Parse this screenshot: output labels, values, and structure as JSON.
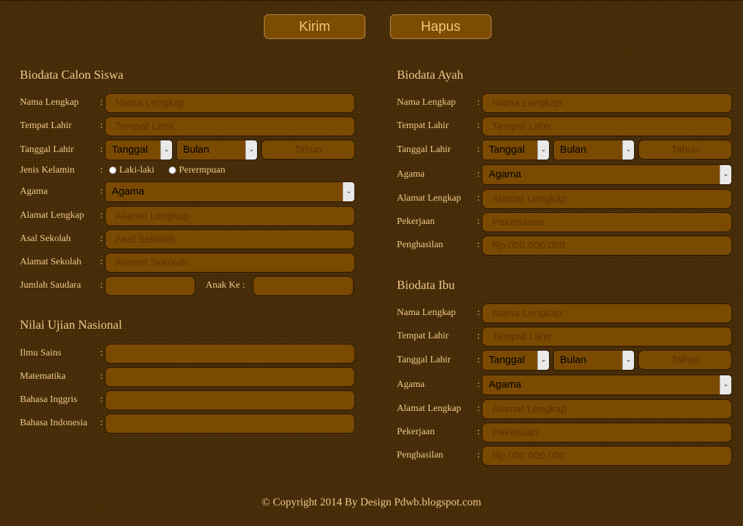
{
  "buttons": {
    "submit": "Kirim",
    "reset": "Hapus"
  },
  "siswa": {
    "title": "Biodata Calon Siswa",
    "nama_label": "Nama Lengkap",
    "nama_ph": "Nama Lengkap",
    "tempat_label": "Tempat Lahir",
    "tempat_ph": "Tempat Lahir",
    "tanggal_label": "Tanggal Lahir",
    "tanggal_sel": "Tanggal",
    "bulan_sel": "Bulan",
    "tahun_ph": "Tahun",
    "jk_label": "Jenis Kelamin",
    "jk_male": "Laki-laki",
    "jk_female": "Perermpuan",
    "agama_label": "Agama",
    "agama_sel": "Agama",
    "alamat_label": "Alamat Lengkap",
    "alamat_ph": "Alamat Lengkap",
    "asal_label": "Asal Sekolah",
    "asal_ph": "Asal Sekolah",
    "alamat_sekolah_label": "Alamat Sekolah",
    "alamat_sekolah_ph": "Alamat Sekolah",
    "saudara_label": "Jumlah Saudara",
    "anak_ke_label": "Anak Ke :"
  },
  "nilai": {
    "title": "Nilai Ujian Nasional",
    "sains": "Ilmu Sains",
    "mtk": "Matematika",
    "inggris": "Bahasa Inggris",
    "indo": "Bahasa Indonesia"
  },
  "ayah": {
    "title": "Biodata Ayah",
    "nama_label": "Nama Lengkap",
    "nama_ph": "Nama Lengkap",
    "tempat_label": "Tempat Lahir",
    "tempat_ph": "Tempat Lahir",
    "tanggal_label": "Tanggal Lahir",
    "tanggal_sel": "Tanggal",
    "bulan_sel": "Bulan",
    "tahun_ph": "Tahun",
    "agama_label": "Agama",
    "agama_sel": "Agama",
    "alamat_label": "Alamat Lengkap",
    "alamat_ph": "Alamat Lengkap",
    "pekerjaan_label": "Pekerjaan",
    "pekerjaan_ph": "Pekerjaaan",
    "penghasilan_label": "Penghasilan",
    "penghasilan_ph": "Rp.000.000.000"
  },
  "ibu": {
    "title": "Biodata Ibu",
    "nama_label": "Nama Lengkap",
    "nama_ph": "Nama Lengkap",
    "tempat_label": "Tempat Lahir",
    "tempat_ph": "Tempat Lahir",
    "tanggal_label": "Tanggal Lahir",
    "tanggal_sel": "Tanggal",
    "bulan_sel": "Bulan",
    "tahun_ph": "Tahun",
    "agama_label": "Agama",
    "agama_sel": "Agama",
    "alamat_label": "Alamat Lengkap",
    "alamat_ph": "Alamat Lengkap",
    "pekerjaan_label": "Pekerjaan",
    "pekerjaan_ph": "Pekerjaan",
    "penghasilan_label": "Penghasilan",
    "penghasilan_ph": "Rp.000.000.000"
  },
  "colon": ":",
  "arrow_glyph": "⌄",
  "icons": {
    "select_arrow": "chevron-down-icon",
    "radio": "radio-button"
  },
  "footer": "© Copyright 2014 By Design Pdwb.blogspot.com",
  "colors": {
    "background": "#4a2e08",
    "field": "#7a4a02",
    "text": "#f0c98a"
  }
}
